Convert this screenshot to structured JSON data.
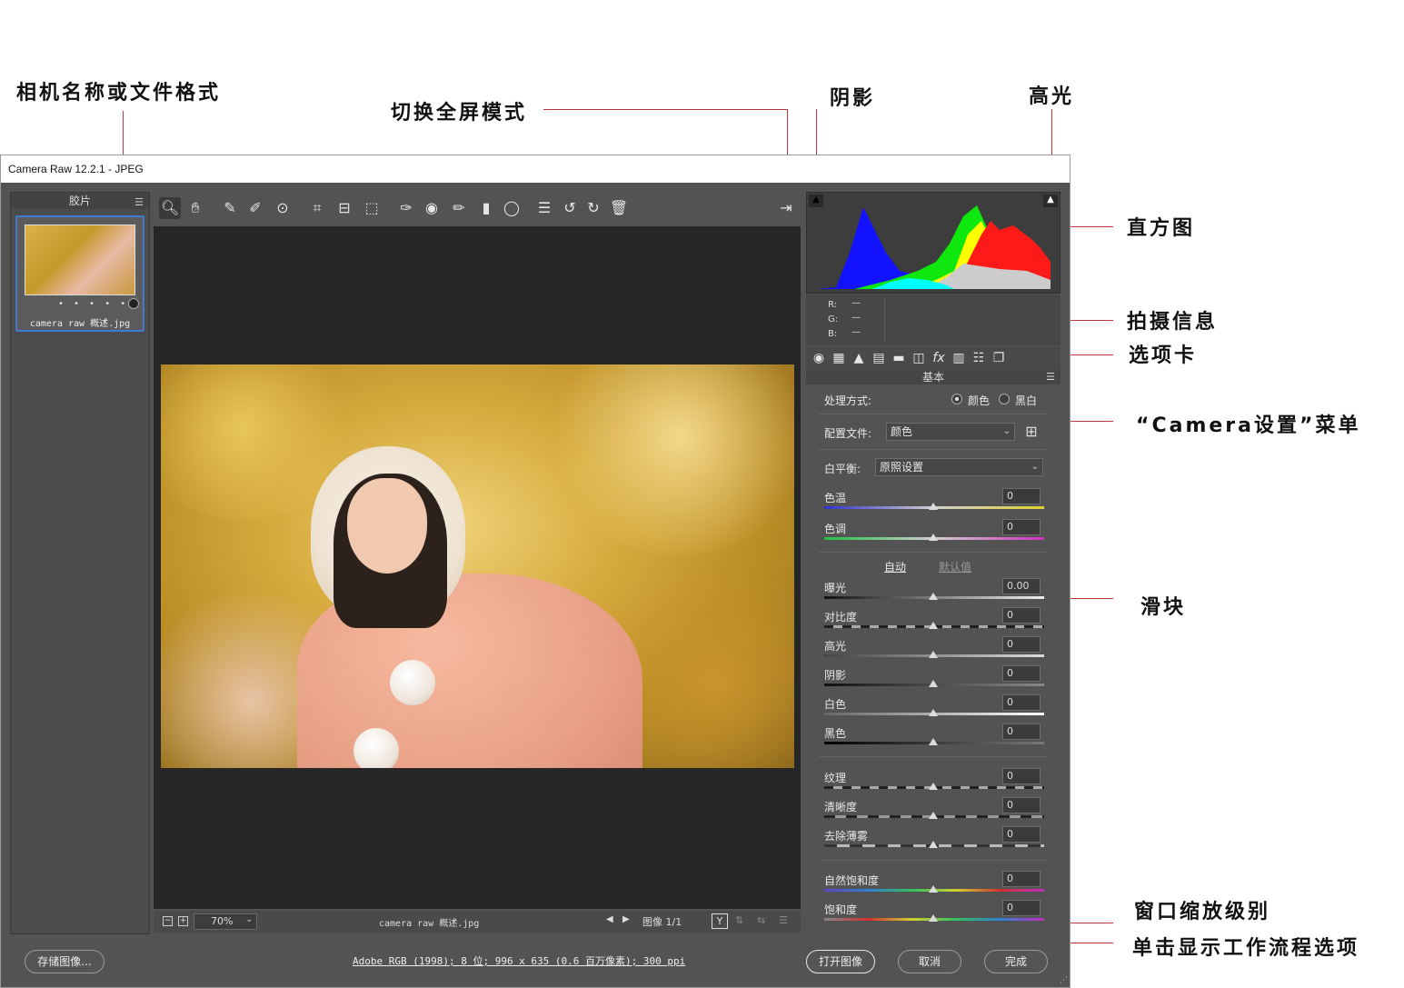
{
  "callouts": {
    "camera_name": "相机名称或文件格式",
    "fullscreen": "切换全屏模式",
    "shadows": "阴影",
    "highlights": "高光",
    "histogram": "直方图",
    "shooting_info": "拍摄信息",
    "tabs": "选项卡",
    "camera_settings_menu": "“Camera设置”菜单",
    "sliders": "滑块",
    "zoom_level": "窗口缩放级别",
    "workflow": "单击显示工作流程选项"
  },
  "window": {
    "title": "Camera Raw 12.2.1 -  JPEG"
  },
  "filmstrip": {
    "header": "胶片",
    "items": [
      {
        "name": "camera raw 概述.jpg",
        "rating_dots": "• • • • •"
      }
    ]
  },
  "toolbar": {
    "tools": [
      "zoom-tool",
      "hand-tool",
      "white-balance-tool",
      "color-sampler-tool",
      "targeted-adjustment-tool",
      "crop-tool",
      "straighten-tool",
      "transform-tool",
      "spot-removal-tool",
      "red-eye-tool",
      "adjustment-brush",
      "graduated-filter",
      "radial-filter",
      "preferences",
      "rotate-left",
      "rotate-right",
      "delete"
    ]
  },
  "statusbar": {
    "zoom": "70%",
    "filename": "camera raw 概述.jpg",
    "image_counter": "图像 1/1",
    "compare_label": "Y"
  },
  "rgb": {
    "r_label": "R:",
    "g_label": "G:",
    "b_label": "B:",
    "r": "—",
    "g": "—",
    "b": "—"
  },
  "panel": {
    "title": "基本",
    "treatment_label": "处理方式:",
    "treatment_color": "颜色",
    "treatment_bw": "黑白",
    "profile_label": "配置文件:",
    "profile_value": "颜色",
    "wb_label": "白平衡:",
    "wb_value": "原照设置",
    "auto": "自动",
    "default": "默认值",
    "sliders": [
      {
        "label": "色温",
        "value": "0"
      },
      {
        "label": "色调",
        "value": "0"
      },
      {
        "label": "曝光",
        "value": "0.00"
      },
      {
        "label": "对比度",
        "value": "0"
      },
      {
        "label": "高光",
        "value": "0"
      },
      {
        "label": "阴影",
        "value": "0"
      },
      {
        "label": "白色",
        "value": "0"
      },
      {
        "label": "黑色",
        "value": "0"
      },
      {
        "label": "纹理",
        "value": "0"
      },
      {
        "label": "清晰度",
        "value": "0"
      },
      {
        "label": "去除薄雾",
        "value": "0"
      },
      {
        "label": "自然饱和度",
        "value": "0"
      },
      {
        "label": "饱和度",
        "value": "0"
      }
    ]
  },
  "bottom": {
    "save": "存储图像...",
    "workflow": "Adobe RGB (1998); 8 位; 996 x 635 (0.6 百万像素); 300 ppi",
    "open": "打开图像",
    "cancel": "取消",
    "done": "完成"
  },
  "colors": {
    "accent_line": "#b83a3a",
    "selection": "#3d7bd6",
    "panel_bg": "#535353"
  }
}
